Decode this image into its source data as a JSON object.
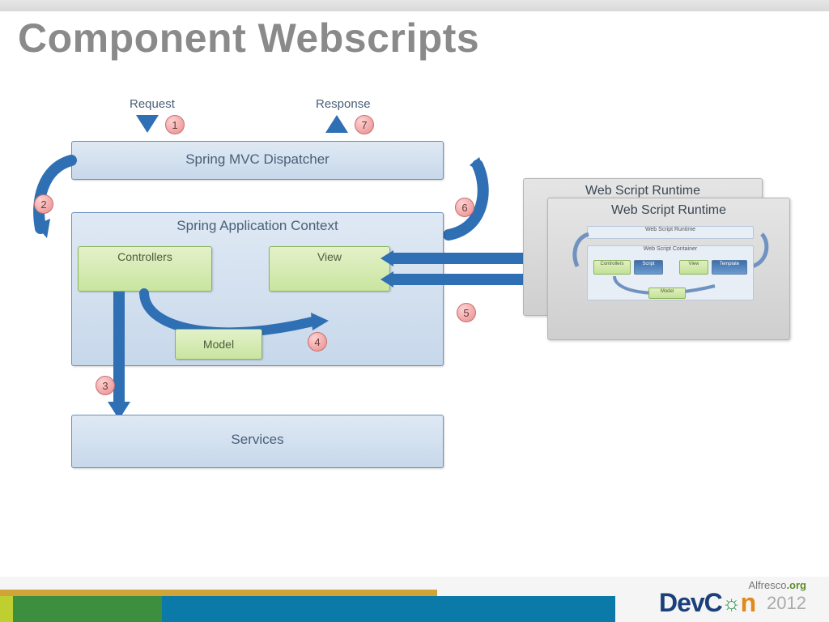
{
  "slide": {
    "title": "Component Webscripts",
    "io": {
      "request": "Request",
      "response": "Response"
    },
    "dispatcher": "Spring MVC Dispatcher",
    "appcontext": "Spring Application Context",
    "controllers": "Controllers",
    "view": "View",
    "model": "Model",
    "services": "Services",
    "runtime1": "Web Script Runtime",
    "runtime2": "Web Script Runtime",
    "mini": {
      "runtime_head": "Web Script Runtime",
      "container_head": "Web Script Container",
      "controllers": "Controllers",
      "view": "View",
      "model": "Model",
      "script": "Script",
      "template": "Template"
    },
    "steps": {
      "s1": "1",
      "s2": "2",
      "s3": "3",
      "s4": "4",
      "s5": "5",
      "s6": "6",
      "s7": "7"
    }
  },
  "footer": {
    "brand_pre": "Alfresco",
    "brand_suf": ".org",
    "logo_dev": "Dev",
    "logo_c": "C",
    "logo_o": "☼",
    "logo_n": "n",
    "year": "2012"
  }
}
